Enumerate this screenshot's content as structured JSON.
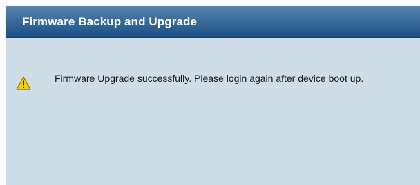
{
  "header": {
    "title": "Firmware Backup and Upgrade"
  },
  "notice": {
    "icon": "warning-icon",
    "message": "Firmware Upgrade successfully. Please login again after device boot up."
  },
  "colors": {
    "header_top": "#5784b0",
    "header_bottom": "#1c4f82",
    "panel_background": "#cfdde6",
    "warning_yellow": "#f5d000"
  }
}
